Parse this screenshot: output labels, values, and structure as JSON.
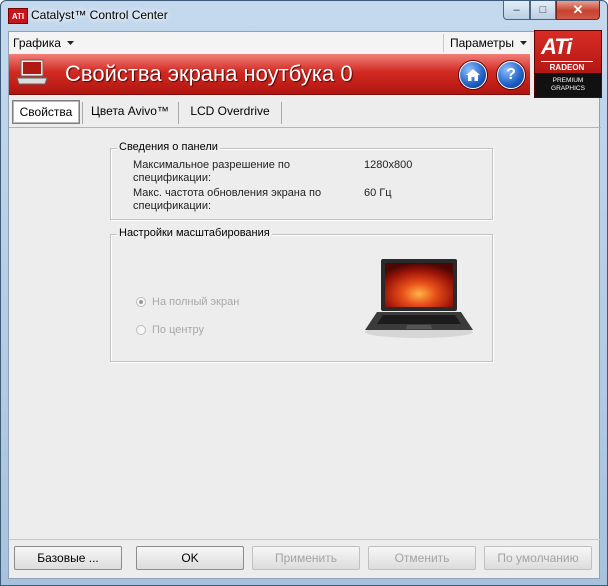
{
  "window": {
    "title": "Catalyst™ Control Center",
    "logo_text": "ATI",
    "controls": {
      "minimize": "–",
      "maximize": "□",
      "close": "✕"
    }
  },
  "menu": {
    "graphics": "Графика",
    "options": "Параметры"
  },
  "banner": {
    "title": "Свойства экрана ноутбука 0",
    "home_icon": "home-icon",
    "help_icon": "help-icon",
    "help_glyph": "?"
  },
  "ati_logo": {
    "brand": "ATi",
    "product": "RADEON",
    "line1": "PREMIUM",
    "line2": "GRAPHICS"
  },
  "tabs": [
    {
      "label": "Свойства",
      "active": true
    },
    {
      "label": "Цвета Avivo™",
      "active": false
    },
    {
      "label": "LCD Overdrive",
      "active": false
    }
  ],
  "panel_info": {
    "legend": "Сведения о панели",
    "rows": [
      {
        "label_line1": "Максимальное разрешение по",
        "label_line2": "спецификации:",
        "value": "1280x800"
      },
      {
        "label_line1": "Макс. частота обновления экрана по",
        "label_line2": "спецификации:",
        "value": "60 Гц"
      }
    ]
  },
  "scaling": {
    "legend": "Настройки масштабирования",
    "options": [
      {
        "label": "На полный экран",
        "selected": true,
        "enabled": false
      },
      {
        "label": "По центру",
        "selected": false,
        "enabled": false
      }
    ]
  },
  "buttons": {
    "basic": "Базовые ...",
    "ok": "OK",
    "apply": "Применить",
    "cancel": "Отменить",
    "defaults": "По умолчанию"
  },
  "colors": {
    "banner_red": "#d22a22",
    "ati_red": "#c8151b",
    "disabled_text": "#a8a8a8"
  }
}
